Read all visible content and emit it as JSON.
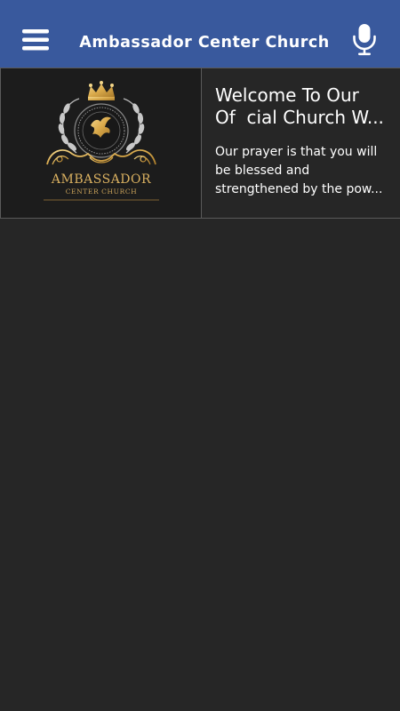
{
  "app_bar": {
    "title": "Ambassador Center Church",
    "background": "#39599d",
    "menu_icon": "hamburger-menu-icon",
    "mic_icon": "microphone-icon"
  },
  "feed": {
    "items": [
      {
        "heading_line1": "Welcome To Our",
        "heading_line2": "Of  cial Church W...",
        "body_line1": "Our prayer is that you will",
        "body_line2": "be blessed and",
        "body_line3": "strengthened by the pow...",
        "logo": {
          "name": "AMBASSADOR",
          "subtitle": "CENTER CHURCH",
          "emblem": "crown-dove-laurel-emblem",
          "gold": "#d9b060"
        }
      }
    ]
  },
  "colors": {
    "background": "#262626",
    "divider": "#5a5a5a",
    "text": "#ffffff"
  }
}
